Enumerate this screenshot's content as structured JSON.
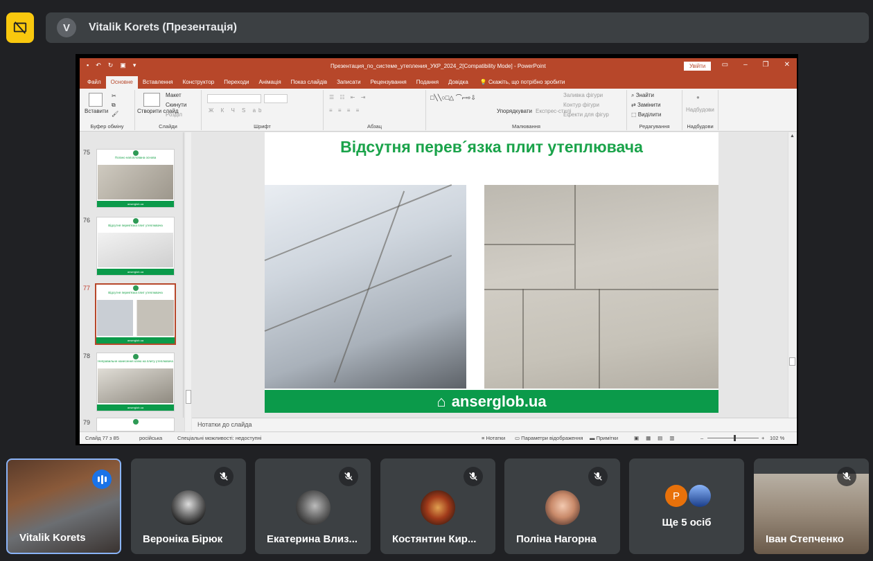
{
  "meet": {
    "presenter_initial": "V",
    "presenter_title": "Vitalik Korets (Презентація)"
  },
  "ppt": {
    "document_title": "Презентация_по_системе_утепления_УКР_2024_2[Compatibility Mode] - PowerPoint",
    "signin_label": "Увійти",
    "tabs": [
      "Файл",
      "Основне",
      "Вставлення",
      "Конструктор",
      "Переходи",
      "Анімація",
      "Показ слайдів",
      "Записати",
      "Рецензування",
      "Подання",
      "Довідка"
    ],
    "tell_me": "Скажіть, що потрібно зробити",
    "ribbon": {
      "paste": "Вставити",
      "clipboard_group": "Буфер обміну",
      "new_slide": "Створити слайд",
      "layout": "Макет",
      "reset": "Скинути",
      "section": "Розділ",
      "slides_group": "Слайди",
      "font_group": "Шрифт",
      "paragraph_group": "Абзац",
      "arrange": "Упорядкувати",
      "quick_styles": "Експрес-стилі",
      "shape_fill": "Заливка фігури",
      "shape_outline": "Контур фігури",
      "shape_effects": "Ефекти для фігур",
      "drawing_group": "Малювання",
      "find": "Знайти",
      "replace": "Замінити",
      "select": "Виділити",
      "editing_group": "Редагування",
      "addins": "Надбудови",
      "addins_group": "Надбудови"
    },
    "thumbnails": [
      {
        "num": "75",
        "title": "Погано напоплована основа"
      },
      {
        "num": "76",
        "title": "Відсутня перев'язка плит утеплювача"
      },
      {
        "num": "77",
        "title": "Відсутня перев'язка плит утеплювача"
      },
      {
        "num": "78",
        "title": "Неправильне нанесення клею на плиту утеплювача"
      },
      {
        "num": "79",
        "title": ""
      }
    ],
    "thumb_footer": "anserglob.ua",
    "slide": {
      "title": "Відсутня перев´язка плит утеплювача",
      "footer": "anserglob.ua"
    },
    "notes_placeholder": "Нотатки до слайда",
    "status": {
      "slide_of": "Слайд 77 з 85",
      "language": "російська",
      "accessibility": "Спеціальні можливості: недоступні",
      "notes": "Нотатки",
      "display_settings": "Параметри відображення",
      "comments": "Примітки",
      "zoom": "102 %"
    }
  },
  "participants": [
    {
      "name": "Vitalik Korets"
    },
    {
      "name": "Вероніка Бірюк"
    },
    {
      "name": "Екатерина Влиз..."
    },
    {
      "name": "Костянтин Кир..."
    },
    {
      "name": "Поліна Нагорна"
    },
    {
      "initial": "P",
      "more_label": "Ще 5 осіб"
    },
    {
      "name": "Іван Степченко"
    }
  ],
  "colors": {
    "meet_bg": "#202124",
    "tile_bg": "#3c4043",
    "present_button": "#f9c80e",
    "ppt_accent": "#b7472a",
    "slide_green": "#1aa34a",
    "footer_green": "#0b9a4a",
    "speaking_blue": "#1a73e8"
  }
}
